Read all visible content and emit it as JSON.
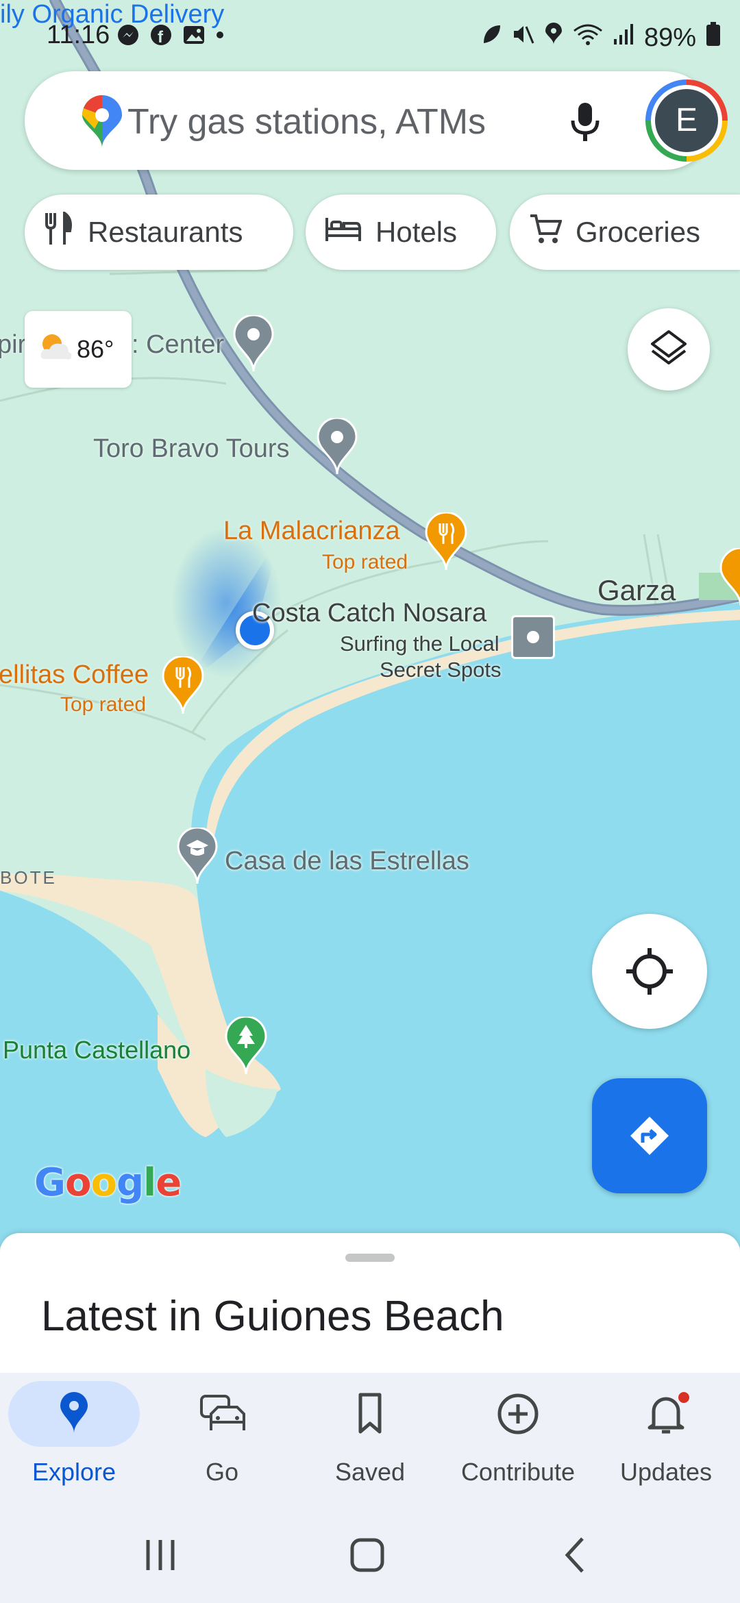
{
  "status_bar": {
    "time": "11:16",
    "battery": "89%",
    "notification_banner": "ily Organic Delivery"
  },
  "search": {
    "placeholder": "Try gas stations, ATMs",
    "avatar_letter": "E"
  },
  "chips": [
    {
      "label": "Restaurants",
      "icon": "fork-knife-icon"
    },
    {
      "label": "Hotels",
      "icon": "bed-icon"
    },
    {
      "label": "Groceries",
      "icon": "cart-icon"
    }
  ],
  "weather": {
    "temp": "86°"
  },
  "map_labels": {
    "center_partial_left": "piri",
    "center_partial_right": ": Center",
    "toro_bravo": "Toro Bravo Tours",
    "la_malacrianza": "La Malacrianza",
    "la_malacrianza_sub": "Top rated",
    "costa_catch": "Costa Catch Nosara",
    "surfing_line1": "Surfing the Local",
    "surfing_line2": "Secret Spots",
    "garza": "Garza",
    "coffee": "ellitas Coffee",
    "coffee_sub": "Top rated",
    "bote": "BOTE",
    "casa": "Casa de las Estrellas",
    "punta": "Punta Castellano",
    "google": "Google"
  },
  "colors": {
    "land": "#cdeee0",
    "water": "#8fdcee",
    "sand": "#f6e8cf",
    "road": "#8a9eb5",
    "accent": "#1a73e8",
    "orange_poi": "#f29900",
    "gray_poi": "#7c8b94",
    "green_poi": "#34a853"
  },
  "sheet": {
    "title": "Latest in Guiones Beach"
  },
  "nav": [
    {
      "label": "Explore",
      "icon": "explore-pin-icon",
      "active": true
    },
    {
      "label": "Go",
      "icon": "car-icon",
      "active": false
    },
    {
      "label": "Saved",
      "icon": "bookmark-icon",
      "active": false
    },
    {
      "label": "Contribute",
      "icon": "plus-circle-icon",
      "active": false
    },
    {
      "label": "Updates",
      "icon": "bell-icon",
      "active": false
    }
  ]
}
